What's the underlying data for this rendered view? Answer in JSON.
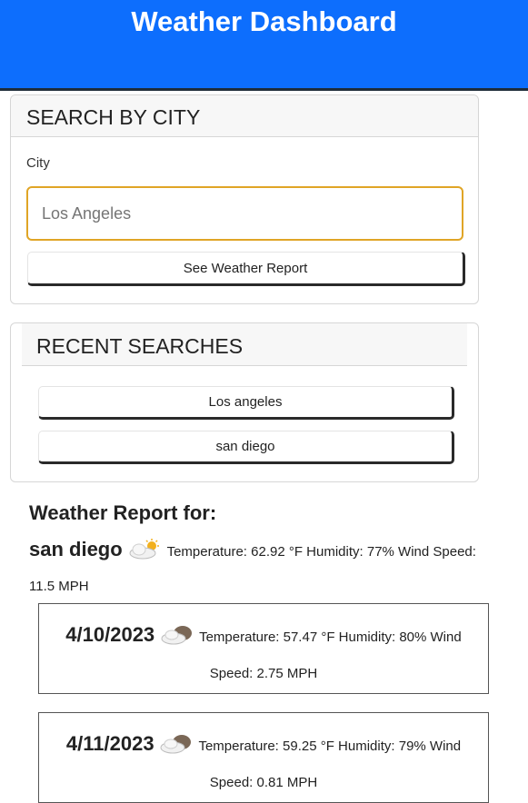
{
  "header": {
    "title": "Weather Dashboard"
  },
  "search": {
    "title": "SEARCH BY CITY",
    "city_label": "City",
    "input_placeholder": "Los Angeles",
    "button_label": "See Weather Report"
  },
  "recent": {
    "title": "RECENT SEARCHES",
    "items": [
      {
        "label": "Los angeles"
      },
      {
        "label": "san diego"
      }
    ]
  },
  "report": {
    "heading": "Weather Report for:",
    "city": "san diego",
    "icon": "partly-cloudy-sun-icon",
    "stats": "Temperature: 62.92 °F Humidity: 77% Wind Speed: 11.5 MPH"
  },
  "forecast": [
    {
      "date": "4/10/2023",
      "icon": "cloudy-icon",
      "stats": "Temperature: 57.47 °F Humidity: 80% Wind Speed: 2.75 MPH"
    },
    {
      "date": "4/11/2023",
      "icon": "cloudy-icon",
      "stats": "Temperature: 59.25 °F Humidity: 79% Wind Speed: 0.81 MPH"
    }
  ],
  "colors": {
    "header_bg": "#0d6efd",
    "input_focus_border": "#e0a526"
  }
}
